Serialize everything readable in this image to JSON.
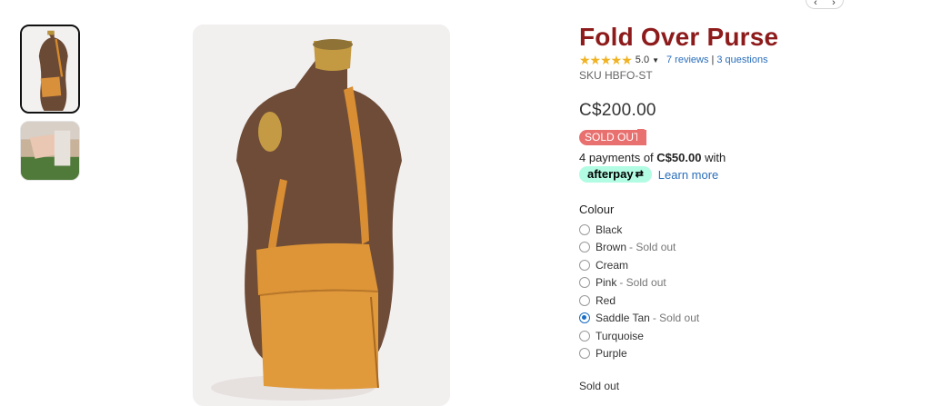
{
  "product": {
    "title": "Fold Over Purse",
    "rating": "5.0",
    "stars": "★★★★★",
    "reviews_link": "7 reviews",
    "separator": "|",
    "questions_link": "3 questions",
    "sku": "SKU HBFO-ST",
    "price": "C$200.00",
    "badge": "SOLD OUT",
    "payments_prefix": "4 payments of",
    "payments_amount": "C$50.00",
    "payments_suffix": "with",
    "afterpay_logo": "afterpay",
    "afterpay_arrows": "⇄",
    "learn_more": "Learn more",
    "colour_label": "Colour",
    "colour_options": [
      {
        "label": "Black",
        "sold_out": "",
        "selected": false
      },
      {
        "label": "Brown",
        "sold_out": "- Sold out",
        "selected": false
      },
      {
        "label": "Cream",
        "sold_out": "",
        "selected": false
      },
      {
        "label": "Pink",
        "sold_out": "- Sold out",
        "selected": false
      },
      {
        "label": "Red",
        "sold_out": "",
        "selected": false
      },
      {
        "label": "Saddle Tan",
        "sold_out": "- Sold out",
        "selected": true
      },
      {
        "label": "Turquoise",
        "sold_out": "",
        "selected": false
      },
      {
        "label": "Purple",
        "sold_out": "",
        "selected": false
      }
    ],
    "status": "Sold out"
  },
  "nav": {
    "prev": "‹",
    "next": "›"
  },
  "colors": {
    "title": "#8e1b1b",
    "badge": "#e8706f",
    "link": "#2a6ebb",
    "star": "#f0b323",
    "afterpay": "#b2fce4",
    "radio_selected": "#1a6ec4"
  }
}
